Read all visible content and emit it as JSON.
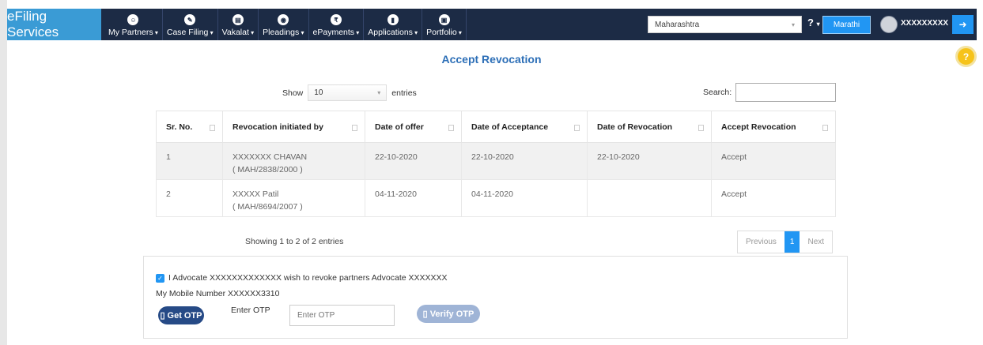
{
  "nav": {
    "brand": "eFiling Services",
    "menu": [
      {
        "label": "My Partners",
        "icon": "partners-icon"
      },
      {
        "label": "Case Filing",
        "icon": "pencil-icon"
      },
      {
        "label": "Vakalat",
        "icon": "document-icon"
      },
      {
        "label": "Pleadings",
        "icon": "handshake-icon"
      },
      {
        "label": "ePayments",
        "icon": "rupee-icon"
      },
      {
        "label": "Applications",
        "icon": "file-icon"
      },
      {
        "label": "Portfolio",
        "icon": "briefcase-icon"
      }
    ],
    "state_value": "Maharashtra",
    "help_label": "?",
    "language_button": "Marathi",
    "username": "XXXXXXXXX",
    "logout_icon": "logout-icon"
  },
  "page_title": "Accept Revocation",
  "table_controls": {
    "show_label": "Show",
    "entries_value": "10",
    "entries_label": "entries",
    "search_label": "Search:"
  },
  "table": {
    "headers": [
      "Sr. No.",
      "Revocation initiated by",
      "Date of offer",
      "Date of Acceptance",
      "Date of Revocation",
      "Accept Revocation"
    ],
    "rows": [
      {
        "sr": "1",
        "name": "XXXXXXX CHAVAN",
        "reg": "( MAH/2838/2000 )",
        "offer": "22-10-2020",
        "acceptance": "22-10-2020",
        "revocation": "22-10-2020",
        "action": "Accept"
      },
      {
        "sr": "2",
        "name": "XXXXX Patil",
        "reg": "( MAH/8694/2007 )",
        "offer": "04-11-2020",
        "acceptance": "04-11-2020",
        "revocation": "",
        "action": "Accept"
      }
    ]
  },
  "pagination": {
    "info": "Showing 1 to 2 of 2 entries",
    "previous": "Previous",
    "current": "1",
    "next": "Next"
  },
  "otp_panel": {
    "declaration": "I Advocate XXXXXXXXXXXXX wish to revoke partners Advocate XXXXXXX",
    "mobile": "My Mobile Number XXXXXX3310",
    "get_otp": "Get OTP",
    "enter_otp_label": "Enter OTP",
    "otp_placeholder": "Enter OTP",
    "verify_otp": "Verify OTP"
  },
  "colors": {
    "nav_bg": "#1c2b45",
    "brand_bg": "#3a9bd5",
    "accent": "#2196f3",
    "title": "#2d6fb7"
  }
}
